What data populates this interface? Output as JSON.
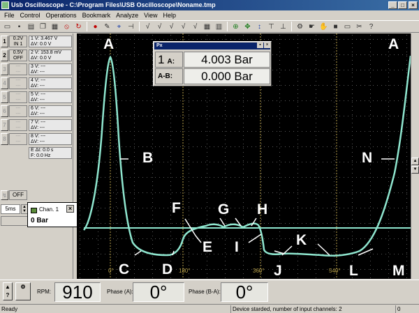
{
  "window": {
    "title": "Usb Oscilloscope - C:\\Program Files\\USB Oscilloscope\\Noname.tmp"
  },
  "menu": [
    "File",
    "Control",
    "Operations",
    "Bookmark",
    "Analyze",
    "View",
    "Help"
  ],
  "channels": [
    {
      "btn": "1",
      "gain_top": "0.2V",
      "gain_bottom": "IN 1",
      "v": "1  V:  3.467 V",
      "dv": "   ΔV:    0.0 V"
    },
    {
      "btn": "2",
      "gain_top": "0.5V",
      "gain_bottom": "OFF",
      "v": "2  V: 153.8 mV",
      "dv": "   ΔV:    0.0 V"
    },
    {
      "btn": "3",
      "gain_top": "---",
      "gain_bottom": "---",
      "v": "3  V:   ---",
      "dv": "   ΔV:   ---"
    },
    {
      "btn": "4",
      "gain_top": "---",
      "gain_bottom": "---",
      "v": "4  V:   ---",
      "dv": "   ΔV:   ---"
    },
    {
      "btn": "5",
      "gain_top": "---",
      "gain_bottom": "---",
      "v": "5  V:   ---",
      "dv": "   ΔV:   ---"
    },
    {
      "btn": "6",
      "gain_top": "---",
      "gain_bottom": "---",
      "v": "6  V:   ---",
      "dv": "   ΔV:   ---"
    },
    {
      "btn": "7",
      "gain_top": "---",
      "gain_bottom": "---",
      "v": "7  V:   ---",
      "dv": "   ΔV:   ---"
    },
    {
      "btn": "8",
      "gain_top": "---",
      "gain_bottom": "---",
      "v": "8  V:   ---",
      "dv": "   ΔV:   ---"
    }
  ],
  "timing": {
    "dt": "E  Δt:    0.0 s",
    "freq": "   F:    0.0 Hz"
  },
  "trigger": {
    "button": "OFF"
  },
  "timebase": {
    "value": "5ms"
  },
  "px_window": {
    "title": "Px",
    "row1_num": "1",
    "row1_label": "A:",
    "row1_value": "4.003 Bar",
    "row2_label": "A-B:",
    "row2_value": "0.000 Bar"
  },
  "chan_tooltip": {
    "name": "Chan. 1",
    "value": "0 Bar"
  },
  "degree_marks": [
    "0°",
    "180°",
    "360°",
    "540°"
  ],
  "point_labels": [
    "A",
    "B",
    "C",
    "D",
    "E",
    "F",
    "G",
    "H",
    "I",
    "J",
    "K",
    "L",
    "M",
    "N",
    "A"
  ],
  "bottom": {
    "rpm_label": "RPM:",
    "rpm_value": "910",
    "phase_a_label": "Phase (A):",
    "phase_a_value": "0°",
    "phase_ba_label": "Phase (B-A):",
    "phase_ba_value": "0°"
  },
  "status": {
    "left": "Ready",
    "middle": "Device starded, number of input channels: 2",
    "right": "0"
  },
  "colors": {
    "trace": "#8fe6cf",
    "grid_dot": "#5a5a5a",
    "cursor_line": "#b8a14a",
    "title_bar": "#0a246a"
  }
}
